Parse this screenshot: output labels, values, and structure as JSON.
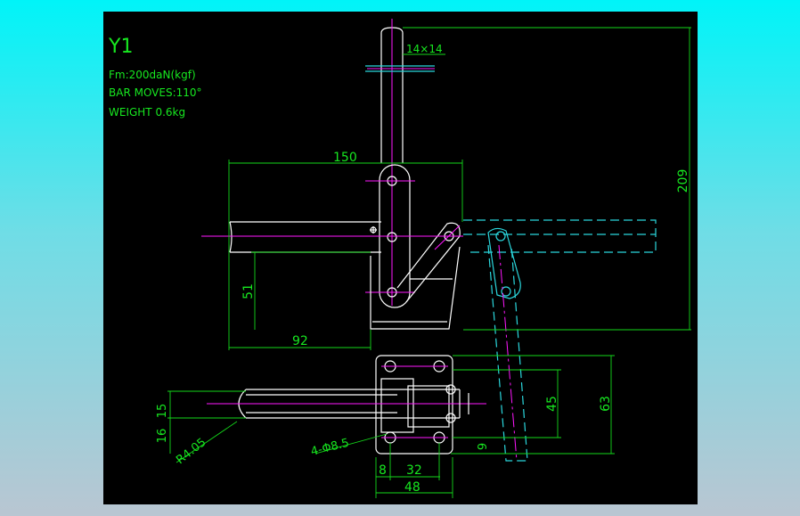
{
  "title_block": {
    "model": "Y1",
    "force": "Fm:200daN(kgf)",
    "bar_moves": "BAR MOVES:110°",
    "weight": "WEIGHT 0.6kg"
  },
  "dimensions": {
    "square": "14×14",
    "width_150": "150",
    "height_209": "209",
    "height_51": "51",
    "length_92": "92",
    "base_63": "63",
    "hole_pitch_45": "45",
    "offset_9": "9",
    "offset_8": "8",
    "hole_pitch_32": "32",
    "base_48": "48",
    "height_16": "16",
    "height_15": "15",
    "radius": "R4.05",
    "holes": "4-Φ8.5"
  },
  "colors": {
    "background": "#000000",
    "dimension": "#17e820",
    "outline": "#ffffff",
    "centerline": "#ff17ff",
    "hidden_position": "#2bd7dd"
  }
}
